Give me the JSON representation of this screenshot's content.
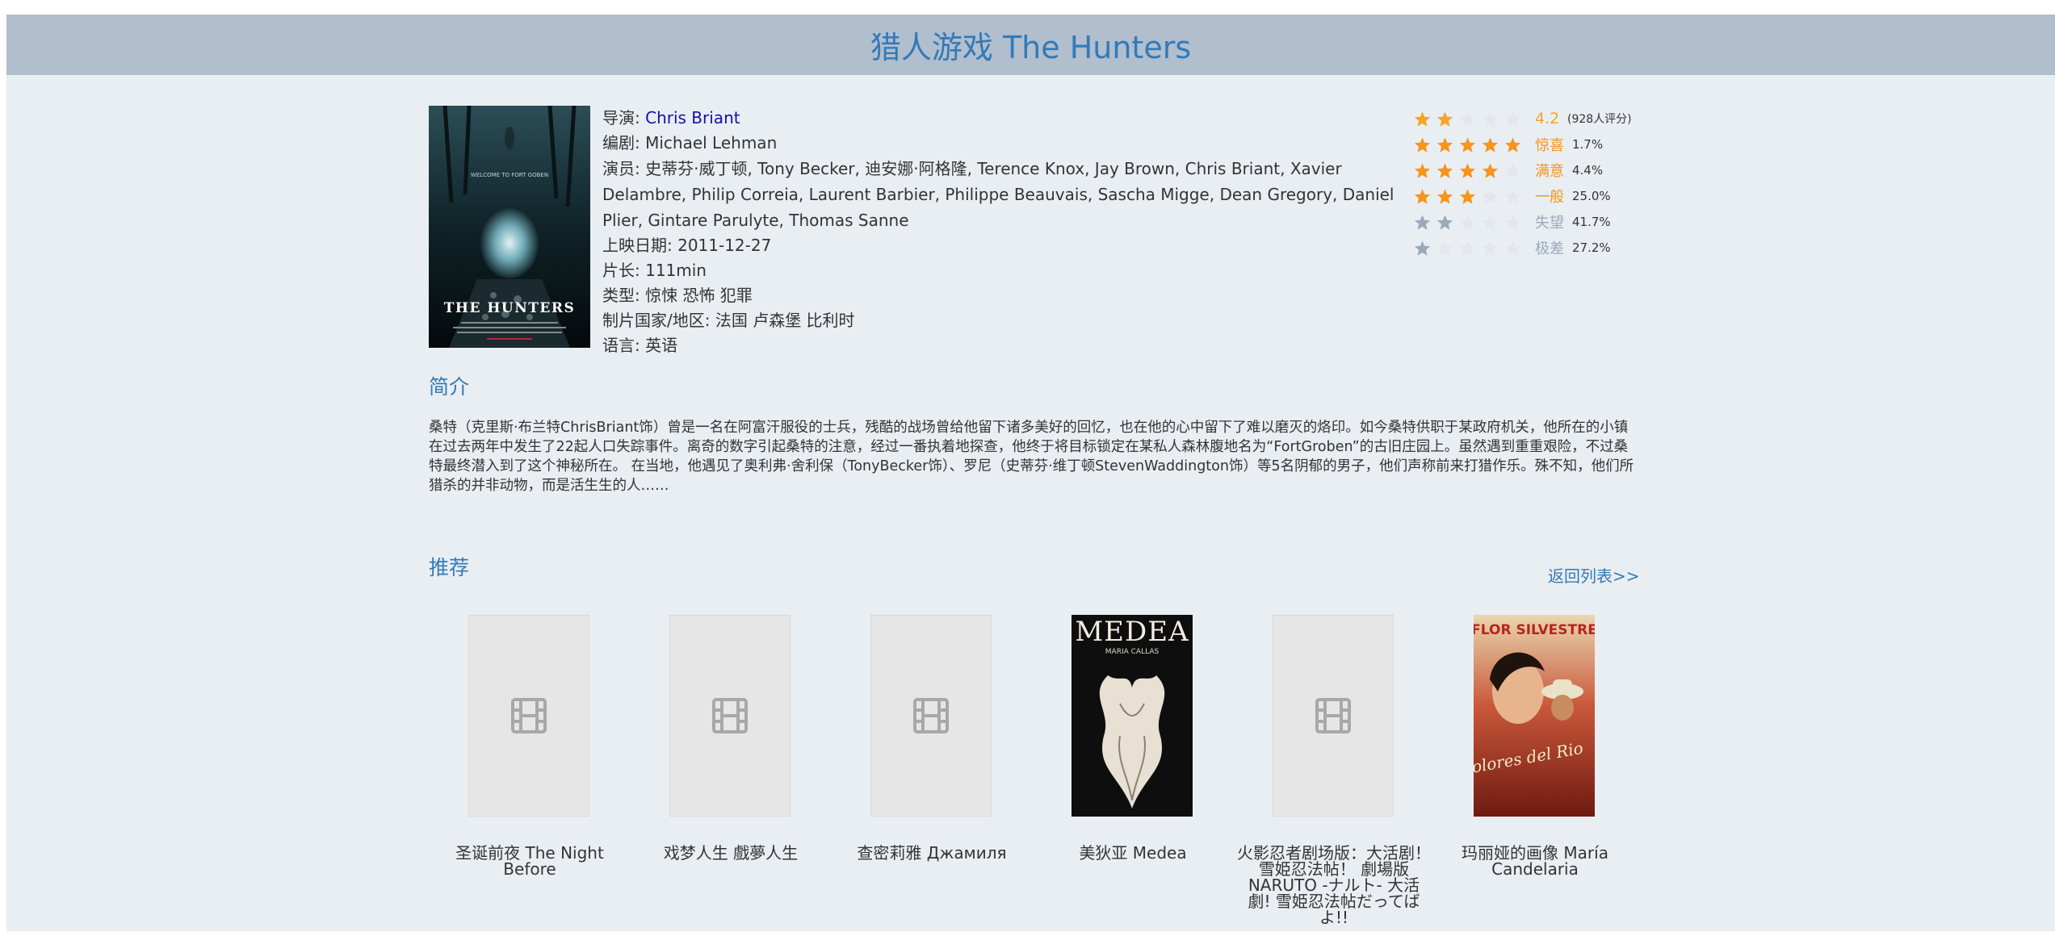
{
  "page": {
    "title": "猎人游戏 The Hunters"
  },
  "movie": {
    "director_label": "导演: ",
    "director": "Chris Briant",
    "writer": "编剧: Michael Lehman",
    "cast": "演员: 史蒂芬·威丁顿, Tony Becker, 迪安娜·阿格隆, Terence Knox, Jay Brown, Chris Briant, Xavier Delambre, Philip Correia, Laurent Barbier, Philippe Beauvais, Sascha Migge, Dean Gregory, Daniel Plier, Gintare Parulyte, Thomas Sanne",
    "release": "上映日期: 2011-12-27",
    "runtime": "片长: 111min",
    "genre": "类型: 惊悚 恐怖 犯罪",
    "country": "制片国家/地区: 法国 卢森堡 比利时",
    "language": "语言: 英语",
    "poster": {
      "tagline": "WELCOME TO FORT GOBEN",
      "title": "THE HUNTERS"
    }
  },
  "rating": {
    "score": "4.2",
    "votes": "(928人评分)",
    "score_stars": 2,
    "score_color": "#f5a623",
    "breakdown": [
      {
        "stars": 5,
        "label": "惊喜",
        "pct": "1.7%",
        "color": "#f7941d"
      },
      {
        "stars": 4,
        "label": "满意",
        "pct": "4.4%",
        "color": "#f7941d"
      },
      {
        "stars": 3,
        "label": "一般",
        "pct": "25.0%",
        "color": "#f7941d"
      },
      {
        "stars": 2,
        "label": "失望",
        "pct": "41.7%",
        "color": "#9aaabb"
      },
      {
        "stars": 1,
        "label": "极差",
        "pct": "27.2%",
        "color": "#9aaabb"
      }
    ]
  },
  "synopsis": {
    "heading": "简介",
    "text": "桑特（克里斯·布兰特ChrisBriant饰）曾是一名在阿富汗服役的士兵，残酷的战场曾给他留下诸多美好的回忆，也在他的心中留下了难以磨灭的烙印。如今桑特供职于某政府机关，他所在的小镇在过去两年中发生了22起人口失踪事件。离奇的数字引起桑特的注意，经过一番执着地探查，他终于将目标锁定在某私人森林腹地名为“FortGroben”的古旧庄园上。虽然遇到重重艰险，不过桑特最终潜入到了这个神秘所在。 在当地，他遇见了奥利弗·舍利保（TonyBecker饰）、罗尼（史蒂芬·维丁顿StevenWaddington饰）等5名阴郁的男子，他们声称前来打猎作乐。殊不知，他们所猎杀的并非动物，而是活生生的人……"
  },
  "recommend": {
    "heading": "推荐",
    "back_link": "返回列表>>",
    "items": [
      {
        "title": "圣诞前夜 The Night Before",
        "thumb": "placeholder"
      },
      {
        "title": "戏梦人生 戲夢人生",
        "thumb": "placeholder"
      },
      {
        "title": "查密莉雅 Джамиля",
        "thumb": "placeholder"
      },
      {
        "title": "美狄亚 Medea",
        "thumb": "medea",
        "poster_top": "MEDEA",
        "poster_sub": "MARIA CALLAS"
      },
      {
        "title": "火影忍者剧场版：大活剧！雪姫忍法帖！ 劇場版 NARUTO -ナルト- 大活劇! 雪姫忍法帖だってばよ!!",
        "thumb": "placeholder"
      },
      {
        "title": "玛丽娅的画像 María Candelaria",
        "thumb": "maria",
        "poster_top": "FLOR SILVESTRE",
        "poster_sub": "Dolores del Rio"
      }
    ]
  }
}
